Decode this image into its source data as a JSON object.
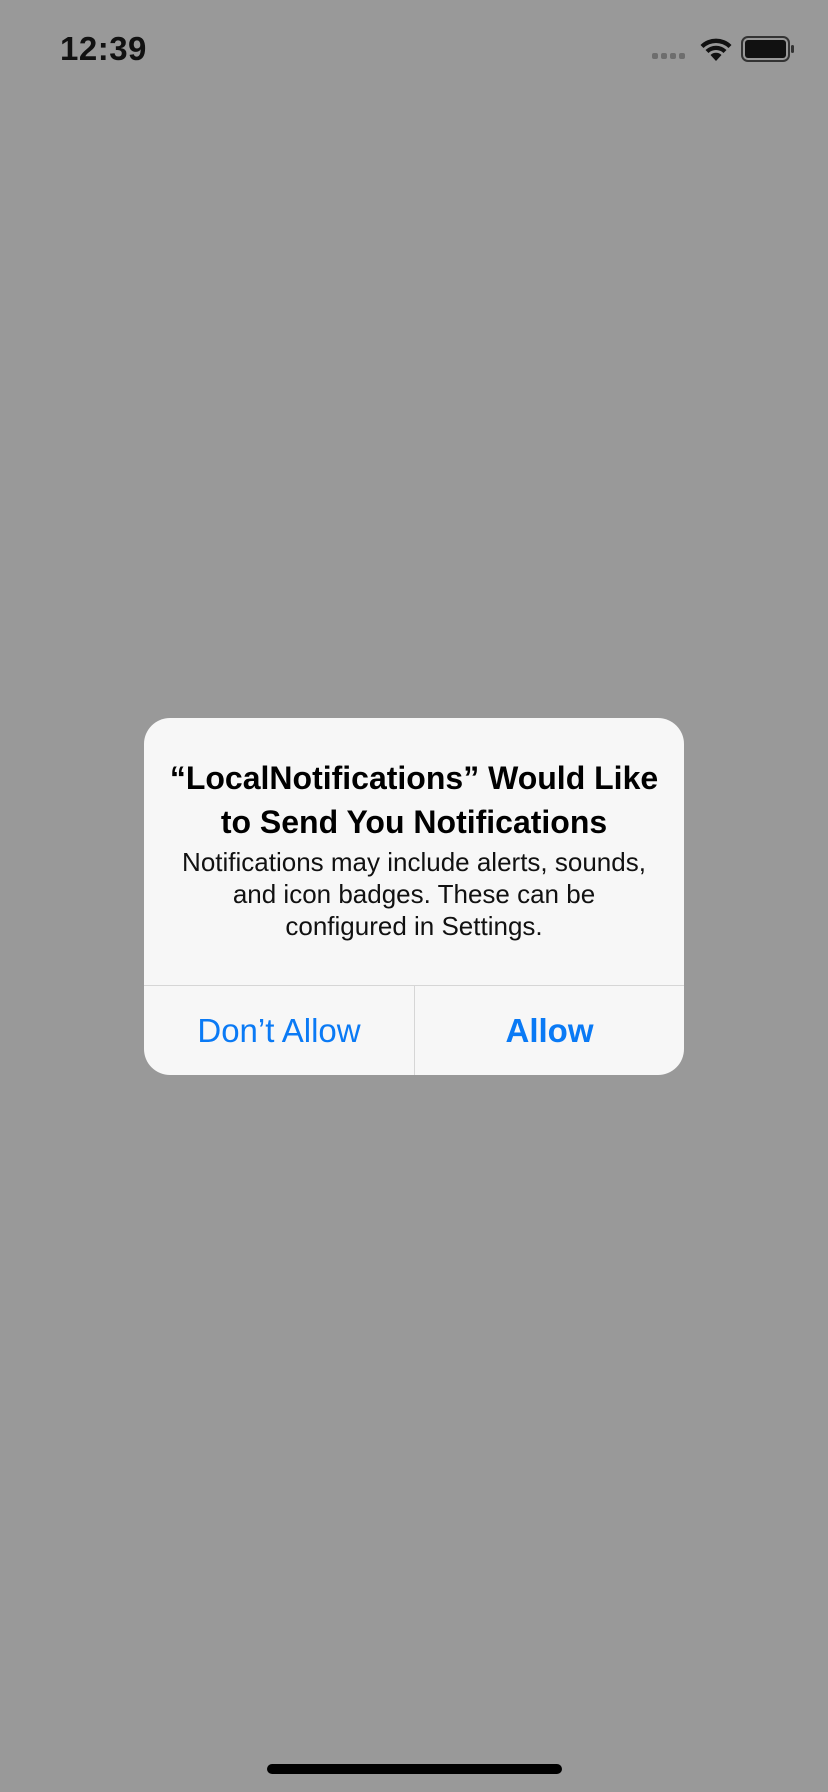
{
  "status_bar": {
    "time": "12:39",
    "icons": [
      "cellular-signal-icon",
      "wifi-icon",
      "battery-icon"
    ]
  },
  "alert": {
    "title": "“LocalNotifications” Would Like to Send You Notifications",
    "message": "Notifications may include alerts, sounds, and icon badges. These can be configured in Settings.",
    "buttons": {
      "dont_allow": "Don’t Allow",
      "allow": "Allow"
    }
  },
  "colors": {
    "backdrop": "#999999",
    "alert_background": "#f7f7f7",
    "button_text": "#0a7af5"
  }
}
